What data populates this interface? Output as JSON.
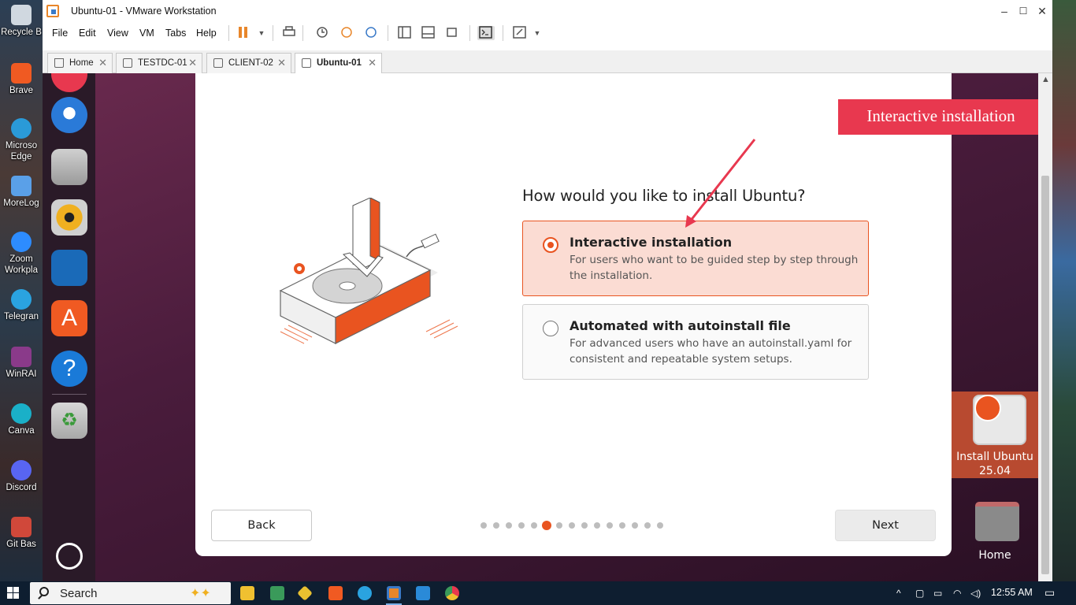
{
  "desktop": {
    "left_icons": [
      {
        "label": "Recycle B",
        "color": "#d0d8e0"
      },
      {
        "label": "Brave",
        "color": "#f05a22"
      },
      {
        "label": "Microso Edge",
        "color": "#2a9ad8"
      },
      {
        "label": "MoreLog",
        "color": "#5aa0e8"
      },
      {
        "label": "Zoom Workpla",
        "color": "#2d8cff"
      },
      {
        "label": "Telegran",
        "color": "#2aa3e0"
      },
      {
        "label": "WinRAI",
        "color": "#8a3a8a"
      },
      {
        "label": "Canva",
        "color": "#1ab0c8"
      },
      {
        "label": "Discord",
        "color": "#5865f2"
      },
      {
        "label": "Git Bas",
        "color": "#d0483a"
      }
    ]
  },
  "window": {
    "title": "Ubuntu-01 - VMware Workstation",
    "controls": {
      "minimize": "–",
      "maximize": "☐",
      "close": "✕"
    }
  },
  "menu": [
    "File",
    "Edit",
    "View",
    "VM",
    "Tabs",
    "Help"
  ],
  "tabs": [
    {
      "label": "Home",
      "close": "✕"
    },
    {
      "label": "TESTDC-01",
      "close": "✕"
    },
    {
      "label": "CLIENT-02",
      "close": "✕"
    },
    {
      "label": "Ubuntu-01",
      "close": "✕"
    }
  ],
  "installer": {
    "question": "How would you like to install Ubuntu?",
    "options": [
      {
        "title": "Interactive installation",
        "desc": "For users who want to be guided step by step through the installation.",
        "selected": true
      },
      {
        "title": "Automated with autoinstall file",
        "desc": "For advanced users who have an autoinstall.yaml for consistent and repeatable system setups.",
        "selected": false
      }
    ],
    "back_label": "Back",
    "next_label": "Next",
    "steps_total": 15,
    "current_step": 6,
    "accent": "#e95420"
  },
  "annotation": {
    "text": "Interactive installation",
    "color": "#e8384f"
  },
  "vm_desktop": {
    "install_label_1": "Install Ubuntu",
    "install_label_2": "25.04",
    "home_label": "Home"
  },
  "taskbar": {
    "search_label": "Search",
    "time": "12:55 AM"
  }
}
